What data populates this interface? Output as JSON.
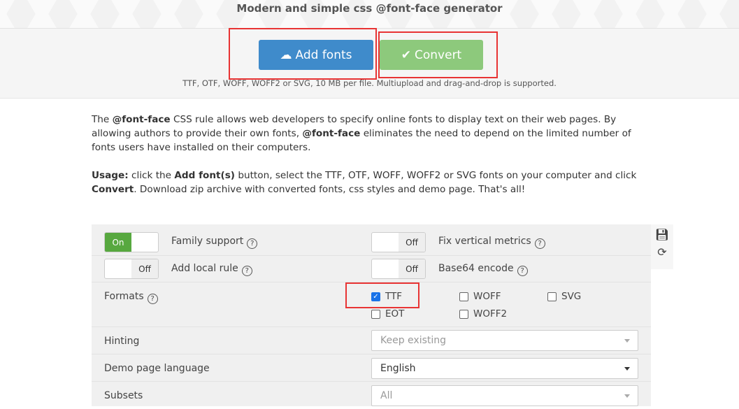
{
  "header": {
    "title": "Modern and simple css @font-face generator"
  },
  "actions": {
    "add_fonts": "Add fonts",
    "convert": "Convert",
    "note": "TTF, OTF, WOFF, WOFF2 or SVG, 10 MB per file. Multiupload and drag-and-drop is supported."
  },
  "intro": {
    "p1_bold1": "@font-face",
    "p1_a": "The ",
    "p1_b": " CSS rule allows web developers to specify online fonts to display text on their web pages. By allowing authors to provide their own fonts, ",
    "p1_bold2": "@font-face",
    "p1_c": " eliminates the need to depend on the limited number of fonts users have installed on their computers.",
    "usage_bold": "Usage:",
    "usage_a": " click the ",
    "usage_btn": "Add font(s)",
    "usage_b": " button, select the TTF, OTF, WOFF, WOFF2 or SVG fonts on your computer and click ",
    "usage_conv": "Convert",
    "usage_c": ". Download zip archive with converted fonts, css styles and demo page. That's all!"
  },
  "options": {
    "family_support": {
      "label": "Family support",
      "state": "On"
    },
    "fix_vertical": {
      "label": "Fix vertical metrics",
      "state": "Off"
    },
    "local_rule": {
      "label": "Add local rule",
      "state": "Off"
    },
    "base64": {
      "label": "Base64 encode",
      "state": "Off"
    },
    "formats_label": "Formats",
    "formats": [
      {
        "label": "TTF",
        "checked": true
      },
      {
        "label": "WOFF",
        "checked": false
      },
      {
        "label": "SVG",
        "checked": false
      },
      {
        "label": "EOT",
        "checked": false
      },
      {
        "label": "WOFF2",
        "checked": false
      }
    ],
    "hinting": {
      "label": "Hinting",
      "value": "Keep existing"
    },
    "demo_lang": {
      "label": "Demo page language",
      "value": "English"
    },
    "subsets": {
      "label": "Subsets",
      "value": "All"
    },
    "help": "?"
  },
  "colors": {
    "add": "#3f8bcb",
    "convert": "#8dc97c",
    "on": "#57a83f",
    "highlight": "#e83434"
  }
}
